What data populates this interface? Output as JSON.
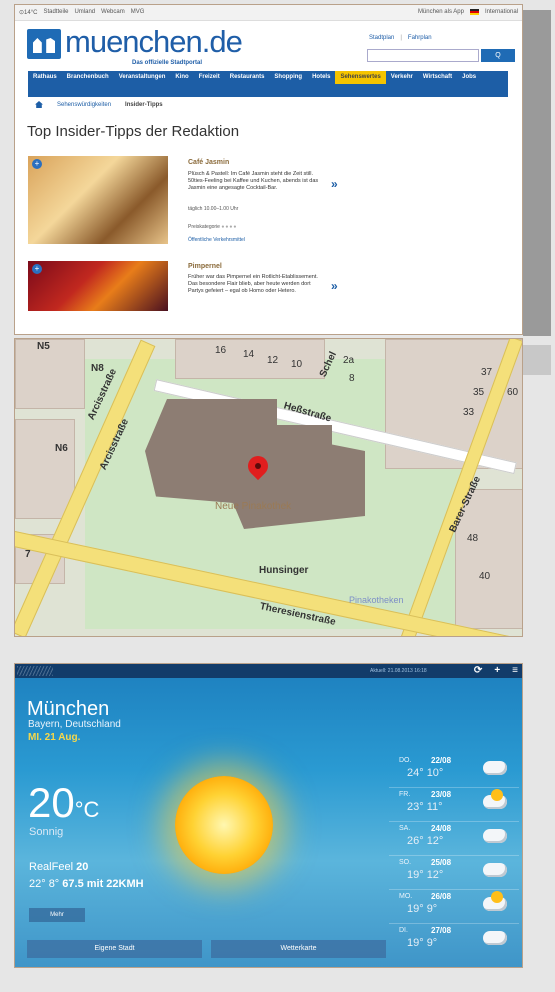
{
  "site": {
    "top_left_links": [
      "⊙14°C",
      "Stadtteile",
      "Umland",
      "Webcam",
      "MVG"
    ],
    "top_right_links": [
      "München als App",
      "International"
    ],
    "logo_main": "muenchen.de",
    "logo_sub": "Das offizielle Stadtportal",
    "service_links": [
      "Stadtplan",
      "Fahrplan"
    ],
    "search_button": "Q",
    "nav_items": [
      "Rathaus",
      "Branchenbuch",
      "Veranstaltungen",
      "Kino",
      "Freizeit",
      "Restaurants",
      "Shopping",
      "Hotels",
      "Sehenswertes",
      "Verkehr",
      "Wirtschaft",
      "Jobs"
    ],
    "breadcrumb": [
      "Sehenswürdigkeiten",
      "Insider-Tipps"
    ],
    "page_title": "Top Insider-Tipps der Redaktion",
    "cards": [
      {
        "title": "Café Jasmin",
        "desc": "Plüsch & Pastell: Im Café Jasmin steht die Zeit still. 50ties-Feeling bei Kaffee und Kuchen, abends ist das Jasmin eine angesagte Cocktail-Bar.",
        "hours": "täglich 10.00–1.00 Uhr",
        "price": "Preiskategorie",
        "transport": "Öffentliche Verkehrsmittel"
      },
      {
        "title": "Pimpernel",
        "desc": "Früher war das Pimpernel ein Rotlicht-Etablissement. Das besondere Flair blieb, aber heute werden dort Partys gefeiert – egal ob Homo oder Hetero."
      }
    ]
  },
  "map": {
    "labels": {
      "n5": "N5",
      "n8": "N8",
      "n6": "N6",
      "n7": "7",
      "arcis1": "Arcisstraße",
      "arcis2": "Arcisstraße",
      "hess": "Heßstraße",
      "barer": "Barer-Straße",
      "theresien": "Theresienstraße",
      "schell": "Schel",
      "neue": "Neue Pinakothek",
      "hunsinger": "Hunsinger",
      "pinakotheken": "Pinakotheken",
      "nums": [
        "16",
        "14",
        "12",
        "10",
        "2a",
        "8",
        "37",
        "35",
        "33",
        "48",
        "40",
        "60"
      ]
    }
  },
  "weather": {
    "updated": "Aktuell: 21.08.2013 16:18",
    "city": "München",
    "region": "Bayern, Deutschland",
    "date": "MI. 21 Aug.",
    "temp": "20",
    "unit": "°C",
    "condition": "Sonnig",
    "realfeel_label": "RealFeel",
    "realfeel_value": "20",
    "hi_lo": "22° 8°",
    "wind": "67.5 mit 22KMH",
    "more_button": "Mehr",
    "btn_city": "Eigene Stadt",
    "btn_map": "Wetterkarte",
    "forecast": [
      {
        "day": "DO.",
        "date": "22/08",
        "temps": "24° 10°",
        "icon": "cloud"
      },
      {
        "day": "FR.",
        "date": "23/08",
        "temps": "23° 11°",
        "icon": "sun-cloud"
      },
      {
        "day": "SA.",
        "date": "24/08",
        "temps": "26° 12°",
        "icon": "cloud"
      },
      {
        "day": "SO.",
        "date": "25/08",
        "temps": "19° 12°",
        "icon": "cloud"
      },
      {
        "day": "MO.",
        "date": "26/08",
        "temps": "19° 9°",
        "icon": "sun-cloud"
      },
      {
        "day": "DI.",
        "date": "27/08",
        "temps": "19° 9°",
        "icon": "cloud"
      }
    ]
  }
}
